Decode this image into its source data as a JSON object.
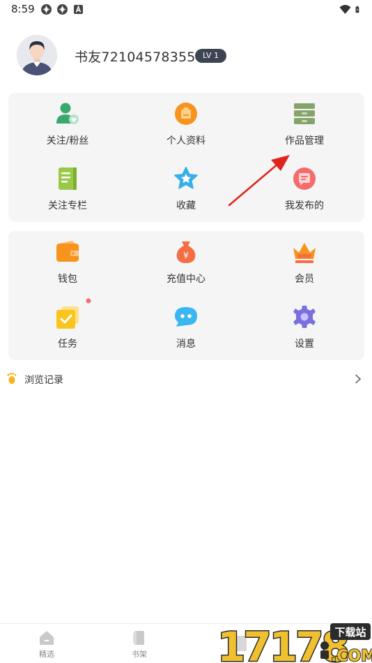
{
  "status_bar": {
    "time": "8:59"
  },
  "profile": {
    "username": "书友72104578355",
    "level": "LV 1"
  },
  "card1": [
    {
      "label": "关注/粉丝",
      "icon": "followers-icon"
    },
    {
      "label": "个人资料",
      "icon": "profile-icon"
    },
    {
      "label": "作品管理",
      "icon": "works-management-icon"
    },
    {
      "label": "关注专栏",
      "icon": "column-icon"
    },
    {
      "label": "收藏",
      "icon": "star-icon"
    },
    {
      "label": "我发布的",
      "icon": "my-posts-icon"
    }
  ],
  "card2": [
    {
      "label": "钱包",
      "icon": "wallet-icon"
    },
    {
      "label": "充值中心",
      "icon": "recharge-icon"
    },
    {
      "label": "会员",
      "icon": "crown-icon"
    },
    {
      "label": "任务",
      "icon": "task-icon"
    },
    {
      "label": "消息",
      "icon": "message-icon"
    },
    {
      "label": "设置",
      "icon": "settings-icon"
    }
  ],
  "history": {
    "label": "浏览记录"
  },
  "bottom_nav": [
    {
      "label": "精选",
      "icon": "home-icon"
    },
    {
      "label": "书架",
      "icon": "bookshelf-icon"
    }
  ],
  "watermark": {
    "text_main": "17178",
    "text_cn": "下载站",
    "text_com": ".COM"
  },
  "colors": {
    "accent_orange": "#f7941d",
    "badge_dark": "#3d4452",
    "card_bg": "#f5f5f5",
    "arrow_red": "#e0241b"
  }
}
